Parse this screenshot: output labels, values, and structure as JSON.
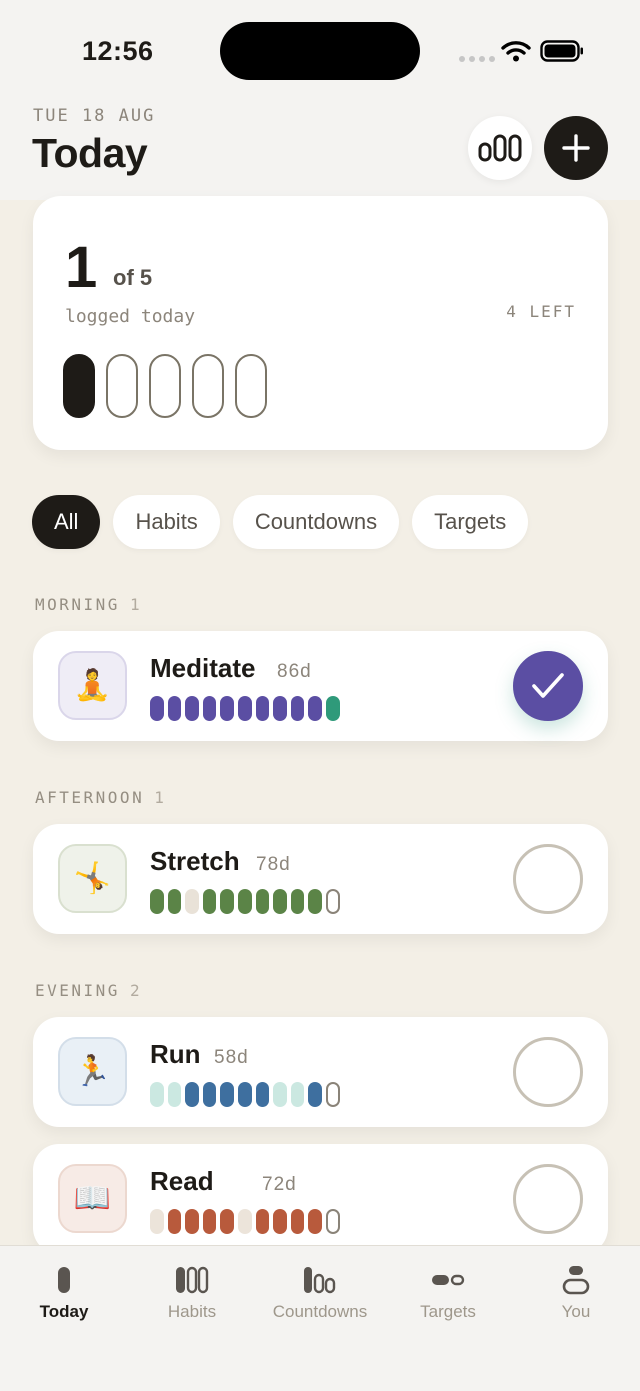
{
  "status": {
    "time": "12:56"
  },
  "header": {
    "date": "TUE 18 AUG",
    "title": "Today"
  },
  "summary": {
    "count": "1",
    "of_total": "of 5",
    "logged_label": "logged today",
    "left_label": "4 LEFT",
    "logged": 1,
    "total": 5
  },
  "filters": [
    "All",
    "Habits",
    "Countdowns",
    "Targets"
  ],
  "sections": {
    "morning": {
      "label": "MORNING",
      "count": "1"
    },
    "afternoon": {
      "label": "AFTERNOON",
      "count": "1"
    },
    "evening": {
      "label": "EVENING",
      "count": "2"
    }
  },
  "habits": [
    {
      "name": "Meditate",
      "days": "86d",
      "emoji": "🧘",
      "done": true,
      "tile_bg": "#efedf6",
      "tile_border": "#dad6ea",
      "history": [
        "p",
        "p",
        "p",
        "p",
        "p",
        "p",
        "p",
        "p",
        "p",
        "p",
        "g"
      ]
    },
    {
      "name": "Stretch",
      "days": "78d",
      "emoji": "🤸",
      "done": false,
      "tile_bg": "#eff2ea",
      "tile_border": "#d9e0cf",
      "history": [
        "g",
        "g",
        "l",
        "g",
        "g",
        "g",
        "g",
        "g",
        "g",
        "g",
        "e"
      ]
    },
    {
      "name": "Run",
      "days": "58d",
      "emoji": "🏃",
      "done": false,
      "tile_bg": "#e9f0f6",
      "tile_border": "#d3dee9",
      "history": [
        "l",
        "l",
        "b",
        "b",
        "b",
        "b",
        "b",
        "l",
        "l",
        "b",
        "e"
      ]
    },
    {
      "name": "Read",
      "days": "72d",
      "emoji": "📖",
      "done": false,
      "tile_bg": "#f7ebe6",
      "tile_border": "#ecd8cf",
      "history": [
        "l",
        "o",
        "o",
        "o",
        "o",
        "l",
        "o",
        "o",
        "o",
        "o",
        "e"
      ]
    }
  ],
  "bar_colors": {
    "meditate": {
      "p": "#5b4ea3",
      "g": "#2f9a7a"
    },
    "stretch": {
      "g": "#5b8447",
      "l": "#e9e2d8"
    },
    "run": {
      "b": "#3e6f9f",
      "l": "#cbe8e1"
    },
    "read": {
      "o": "#b85a3c",
      "l": "#ece4da"
    }
  },
  "tabbar": [
    {
      "label": "Today",
      "icon": "today-icon",
      "active": true
    },
    {
      "label": "Habits",
      "icon": "habits-icon",
      "active": false
    },
    {
      "label": "Countdowns",
      "icon": "countdowns-icon",
      "active": false
    },
    {
      "label": "Targets",
      "icon": "targets-icon",
      "active": false
    },
    {
      "label": "You",
      "icon": "profile-icon",
      "active": false
    }
  ]
}
